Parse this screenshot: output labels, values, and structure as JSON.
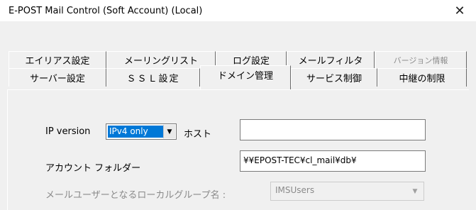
{
  "window": {
    "title": "E-POST Mail Control (Soft Account) (Local)",
    "close_glyph": "✕"
  },
  "tabs": {
    "row1": [
      {
        "label": "エイリアス設定",
        "disabled": false
      },
      {
        "label": "メーリングリスト",
        "disabled": false
      },
      {
        "label": "ログ設定",
        "disabled": false
      },
      {
        "label": "メールフィルタ",
        "disabled": false
      },
      {
        "label": "バージョン情報",
        "disabled": true
      }
    ],
    "row2": [
      {
        "label": "サーバー設定",
        "selected": false
      },
      {
        "label": "ＳＳＬ設定",
        "selected": false
      },
      {
        "label": "ドメイン管理",
        "selected": true
      },
      {
        "label": "サービス制御",
        "selected": false
      },
      {
        "label": "中継の制限",
        "selected": false
      }
    ]
  },
  "form": {
    "ip_version_label": "IP version",
    "ip_version_value": "IPv4 only",
    "host_label": "ホスト",
    "host_value": "",
    "account_folder_label": "アカウント フォルダー",
    "account_folder_value": "¥¥EPOST-TEC¥cl_mail¥db¥",
    "local_group_label": "メールユーザーとなるローカルグループ名 :",
    "local_group_value": "IMSUsers"
  },
  "icons": {
    "dropdown": "chevron-down-icon",
    "close": "close-icon"
  }
}
